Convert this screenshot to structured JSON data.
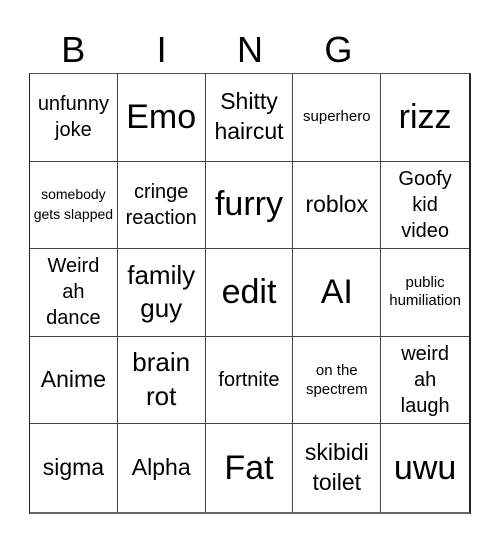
{
  "header": {
    "letters": [
      "B",
      "I",
      "N",
      "G",
      ""
    ]
  },
  "board": {
    "cells": [
      "unfunny joke",
      "Emo",
      "Shitty haircut",
      "superhero",
      "rizz",
      "somebody gets slapped",
      "cringe reaction",
      "furry",
      "roblox",
      "Goofy kid video",
      "Weird ah dance",
      "family guy",
      "edit",
      "AI",
      "public humiliation",
      "Anime",
      "brain rot",
      "fortnite",
      "on the spectrem",
      "weird ah laugh",
      "sigma",
      "Alpha",
      "Fat",
      "skibidi toilet",
      "uwu"
    ]
  }
}
